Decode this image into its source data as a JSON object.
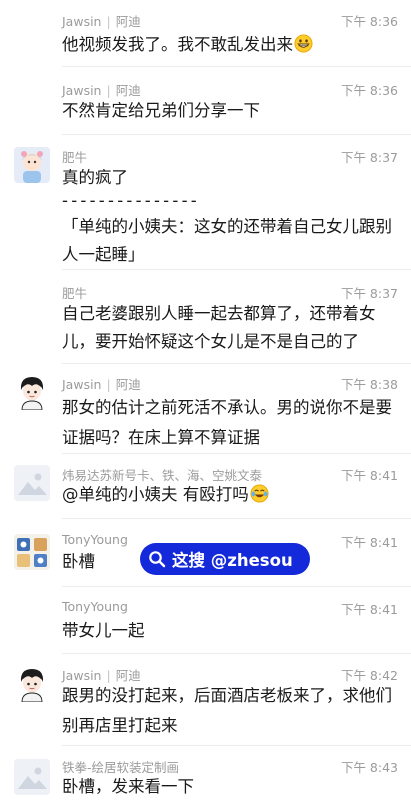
{
  "messages": [
    {
      "sender": "Jawsin",
      "remark": "阿迪",
      "time": "下午 8:36",
      "lines": [
        "他视频发我了。我不敢乱发出来"
      ],
      "emoji": "grin-emoji"
    },
    {
      "sender": "Jawsin",
      "remark": "阿迪",
      "time": "下午 8:36",
      "lines": [
        "不然肯定给兄弟们分享一下"
      ]
    },
    {
      "sender": "肥牛",
      "time": "下午 8:37",
      "lines": [
        "真的疯了",
        "- - - - - - - - - - - - - - -",
        "「单纯的小姨夫：这女的还带着自己女儿跟别",
        "人一起睡」"
      ]
    },
    {
      "sender": "肥牛",
      "time": "下午 8:37",
      "lines": [
        "自己老婆跟别人睡一起去都算了，还带着女",
        "儿，要开始怀疑这个女儿是不是自己的了"
      ]
    },
    {
      "sender": "Jawsin",
      "remark": "阿迪",
      "time": "下午 8:38",
      "lines": [
        "那女的估计之前死活不承认。男的说你不是要",
        "证据吗？在床上算不算证据"
      ]
    },
    {
      "sender": "炜易达苏新号卡、铁、海、空姚文泰",
      "time": "下午 8:41",
      "lines": [
        "@单纯的小姨夫 有殴打吗"
      ],
      "emoji": "laugh-cry-emoji"
    },
    {
      "sender": "TonyYoung",
      "time": "下午 8:41",
      "lines": [
        "卧槽"
      ]
    },
    {
      "sender": "TonyYoung",
      "time": "下午 8:41",
      "lines": [
        "带女儿一起"
      ]
    },
    {
      "sender": "Jawsin",
      "remark": "阿迪",
      "time": "下午 8:42",
      "lines": [
        "跟男的没打起来，后面酒店老板来了，求他们",
        "别再店里打起来"
      ]
    },
    {
      "sender": "铁拳-绘居软装定制画",
      "time": "下午 8:43",
      "lines": [
        "卧槽，发来看一下"
      ]
    }
  ],
  "watermark": {
    "text": "这搜 @zhesou",
    "color": "#1429d9"
  },
  "colors": {
    "meta": "#9b9b9b",
    "text": "#191919",
    "divider": "#ececec"
  }
}
